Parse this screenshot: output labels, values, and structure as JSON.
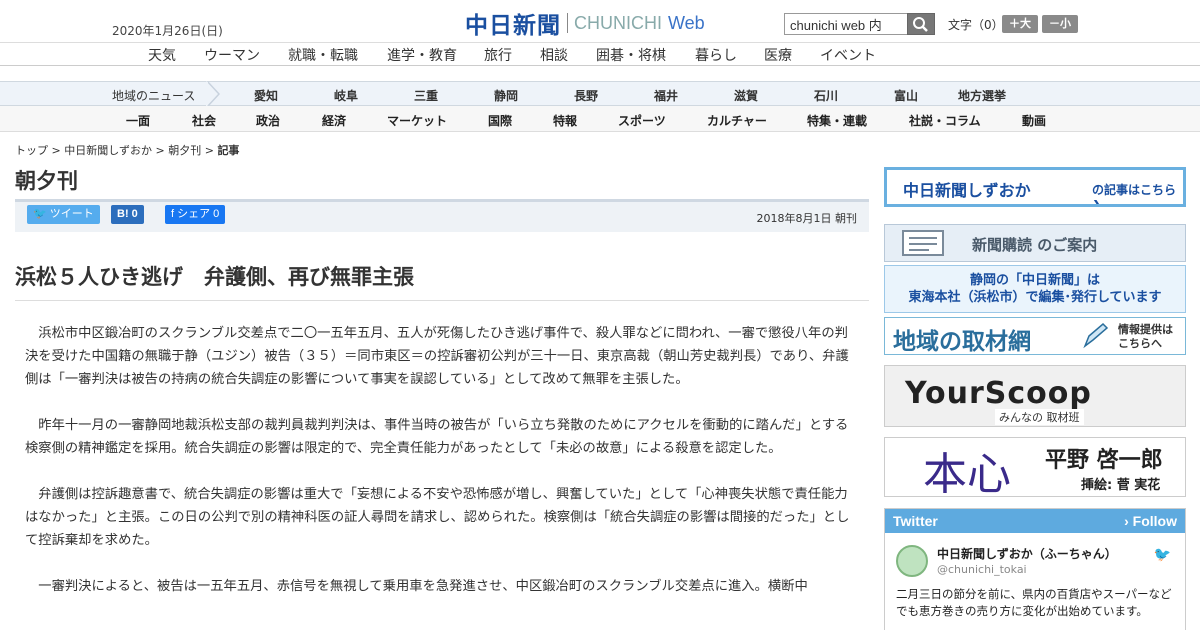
{
  "header": {
    "date": "2020年1月26日(日)",
    "logo_jp": "中日新聞",
    "logo_en": "CHUNICHI",
    "logo_web": "Web",
    "search_value": "chunichi web 内",
    "font_label": "文字（0）",
    "font_up": "＋大",
    "font_down": "－小"
  },
  "global_nav": [
    "天気",
    "ウーマン",
    "就職・転職",
    "進学・教育",
    "旅行",
    "相談",
    "囲碁・将棋",
    "暮らし",
    "医療",
    "イベント"
  ],
  "region_nav": {
    "label": "地域のニュース",
    "items": [
      "愛知",
      "岐阜",
      "三重",
      "静岡",
      "長野",
      "福井",
      "滋賀",
      "石川",
      "富山",
      "地方選挙"
    ]
  },
  "category_nav": [
    "一面",
    "社会",
    "政治",
    "経済",
    "マーケット",
    "国際",
    "特報",
    "スポーツ",
    "カルチャー",
    "特集・連載",
    "社説・コラム",
    "動画"
  ],
  "breadcrumb": {
    "items": [
      "トップ",
      "中日新聞しずおか",
      "朝夕刊"
    ],
    "current": "記事",
    "sep": " > "
  },
  "section_title": "朝夕刊",
  "share": {
    "tweet": "ツイート",
    "hatena": "B! 0",
    "facebook": "f シェア 0",
    "pub_date": "2018年8月1日 朝刊"
  },
  "article": {
    "headline": "浜松５人ひき逃げ　弁護側、再び無罪主張",
    "paragraphs": [
      "浜松市中区鍛冶町のスクランブル交差点で二〇一五年五月、五人が死傷したひき逃げ事件で、殺人罪などに問われ、一審で懲役八年の判決を受けた中国籍の無職于静（ユジン）被告（３５）＝同市東区＝の控訴審初公判が三十一日、東京高裁（朝山芳史裁判長）であり、弁護側は「一審判決は被告の持病の統合失調症の影響について事実を誤認している」として改めて無罪を主張した。",
      "昨年十一月の一審静岡地裁浜松支部の裁判員裁判判決は、事件当時の被告が「いら立ち発散のためにアクセルを衝動的に踏んだ」とする検察側の精神鑑定を採用。統合失調症の影響は限定的で、完全責任能力があったとして「未必の故意」による殺意を認定した。",
      "弁護側は控訴趣意書で、統合失調症の影響は重大で「妄想による不安や恐怖感が増し、興奮していた」として「心神喪失状態で責任能力はなかった」と主張。この日の公判で別の精神科医の証人尋問を請求し、認められた。検察側は「統合失調症の影響は間接的だった」として控訴棄却を求めた。",
      "一審判決によると、被告は一五年五月、赤信号を無視して乗用車を急発進させ、中区鍛冶町のスクランブル交差点に進入。横断中"
    ]
  },
  "sidebar": {
    "banner1_main": "中日新聞しずおか",
    "banner1_sub": "の記事はこちら ❯",
    "banner2": "新聞購読 のご案内",
    "banner3_line1": "静岡の「中日新聞」は",
    "banner3_line2": "東海本社（浜松市）で編集･発行しています",
    "banner4_main": "地域の取材網",
    "banner4_sub1": "情報提供は",
    "banner4_sub2": "こちらへ",
    "banner5_main": "YourScoop",
    "banner5_sub": "みんなの 取材班",
    "banner6_main": "本心",
    "banner6_author": "平野 啓一郎",
    "banner6_illus": "挿絵: 菅 実花"
  },
  "twitter": {
    "header": "Twitter",
    "follow": "› Follow",
    "name": "中日新聞しずおか（ふーちゃん）",
    "handle": "@chunichi_tokai",
    "text": "二月三日の節分を前に、県内の百貨店やスーパーなどでも恵方巻きの売り方に変化が出始めています。"
  },
  "colors": {
    "brand": "#1a4fa0",
    "twitter": "#5eaadf",
    "tweet_btn": "#55acee",
    "hatena_btn": "#2c6ebd",
    "facebook_btn": "#1877f2"
  }
}
